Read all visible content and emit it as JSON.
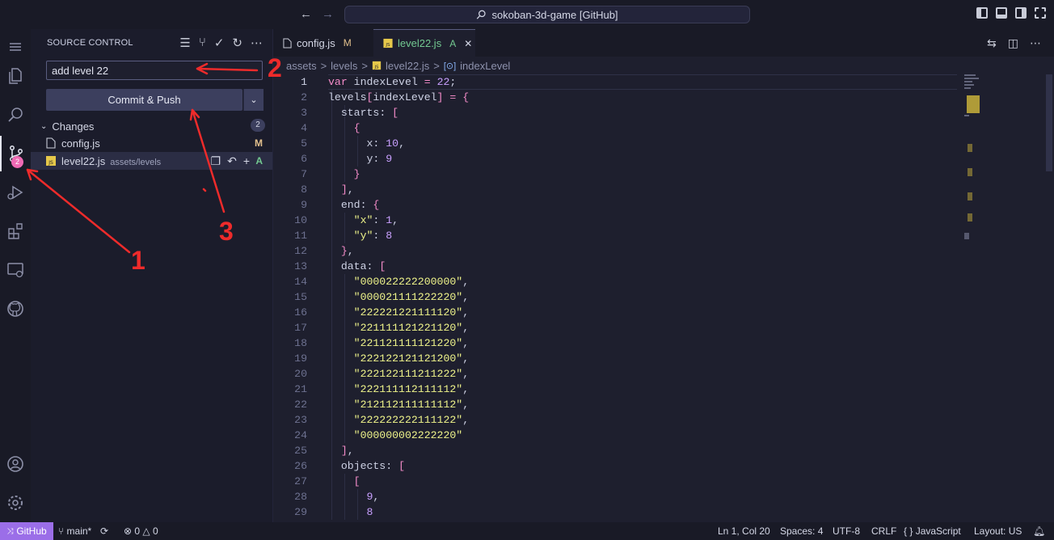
{
  "titlebar": {
    "back_glyph": "←",
    "forward_glyph": "→",
    "command_center": "sokoban-3d-game [GitHub]"
  },
  "activity_bar": {
    "source_control_badge": "2"
  },
  "sidebar": {
    "title": "SOURCE CONTROL",
    "commit_message": "add level 22",
    "commit_button": "Commit & Push",
    "changes_label": "Changes",
    "changes_count": "2",
    "files": [
      {
        "name": "config.js",
        "path": "",
        "status": "M",
        "status_color": "#e2c08d"
      },
      {
        "name": "level22.js",
        "path": "assets/levels",
        "status": "A",
        "status_color": "#73c991"
      }
    ]
  },
  "tabs": [
    {
      "label": "config.js",
      "mark": "M"
    },
    {
      "label": "level22.js",
      "mark": "A",
      "close": "✕"
    }
  ],
  "breadcrumb": {
    "items": [
      "assets",
      "levels",
      "level22.js",
      "indexLevel"
    ],
    "sep": ">"
  },
  "editor": {
    "current_line": "1",
    "lines": [
      {
        "n": "1",
        "text": "var indexLevel = 22;"
      },
      {
        "n": "2",
        "text": "levels[indexLevel] = {"
      },
      {
        "n": "3",
        "text": "  starts: ["
      },
      {
        "n": "4",
        "text": "    {"
      },
      {
        "n": "5",
        "text": "      x: 10,"
      },
      {
        "n": "6",
        "text": "      y: 9"
      },
      {
        "n": "7",
        "text": "    }"
      },
      {
        "n": "8",
        "text": "  ],"
      },
      {
        "n": "9",
        "text": "  end: {"
      },
      {
        "n": "10",
        "text": "    \"x\": 1,"
      },
      {
        "n": "11",
        "text": "    \"y\": 8"
      },
      {
        "n": "12",
        "text": "  },"
      },
      {
        "n": "13",
        "text": "  data: ["
      },
      {
        "n": "14",
        "text": "    \"000022222200000\","
      },
      {
        "n": "15",
        "text": "    \"000021111222220\","
      },
      {
        "n": "16",
        "text": "    \"222221221111120\","
      },
      {
        "n": "17",
        "text": "    \"221111121221120\","
      },
      {
        "n": "18",
        "text": "    \"221121111121220\","
      },
      {
        "n": "19",
        "text": "    \"222122121121200\","
      },
      {
        "n": "20",
        "text": "    \"222122111211222\","
      },
      {
        "n": "21",
        "text": "    \"222111112111112\","
      },
      {
        "n": "22",
        "text": "    \"212112111111112\","
      },
      {
        "n": "23",
        "text": "    \"222222222111122\","
      },
      {
        "n": "24",
        "text": "    \"000000002222220\""
      },
      {
        "n": "25",
        "text": "  ],"
      },
      {
        "n": "26",
        "text": "  objects: ["
      },
      {
        "n": "27",
        "text": "    ["
      },
      {
        "n": "28",
        "text": "      9,"
      },
      {
        "n": "29",
        "text": "      8"
      }
    ]
  },
  "statusbar": {
    "remote": "GitHub",
    "branch": "main*",
    "errors": "0",
    "warnings": "0",
    "position": "Ln 1, Col 20",
    "spaces": "Spaces: 4",
    "encoding": "UTF-8",
    "eol": "CRLF",
    "language": "JavaScript",
    "language_glyph": "{ }",
    "layout": "Layout: US"
  },
  "annotations": {
    "one": "1",
    "two": "2",
    "three": "3",
    "color": "#ee2b2b"
  },
  "colors": {
    "keyword": "#f38bc8",
    "number": "#c9a0ff",
    "string": "#eef38a",
    "property": "#cdd1e4",
    "punct": "#f38bc8",
    "accent": "#9b6ee8"
  }
}
